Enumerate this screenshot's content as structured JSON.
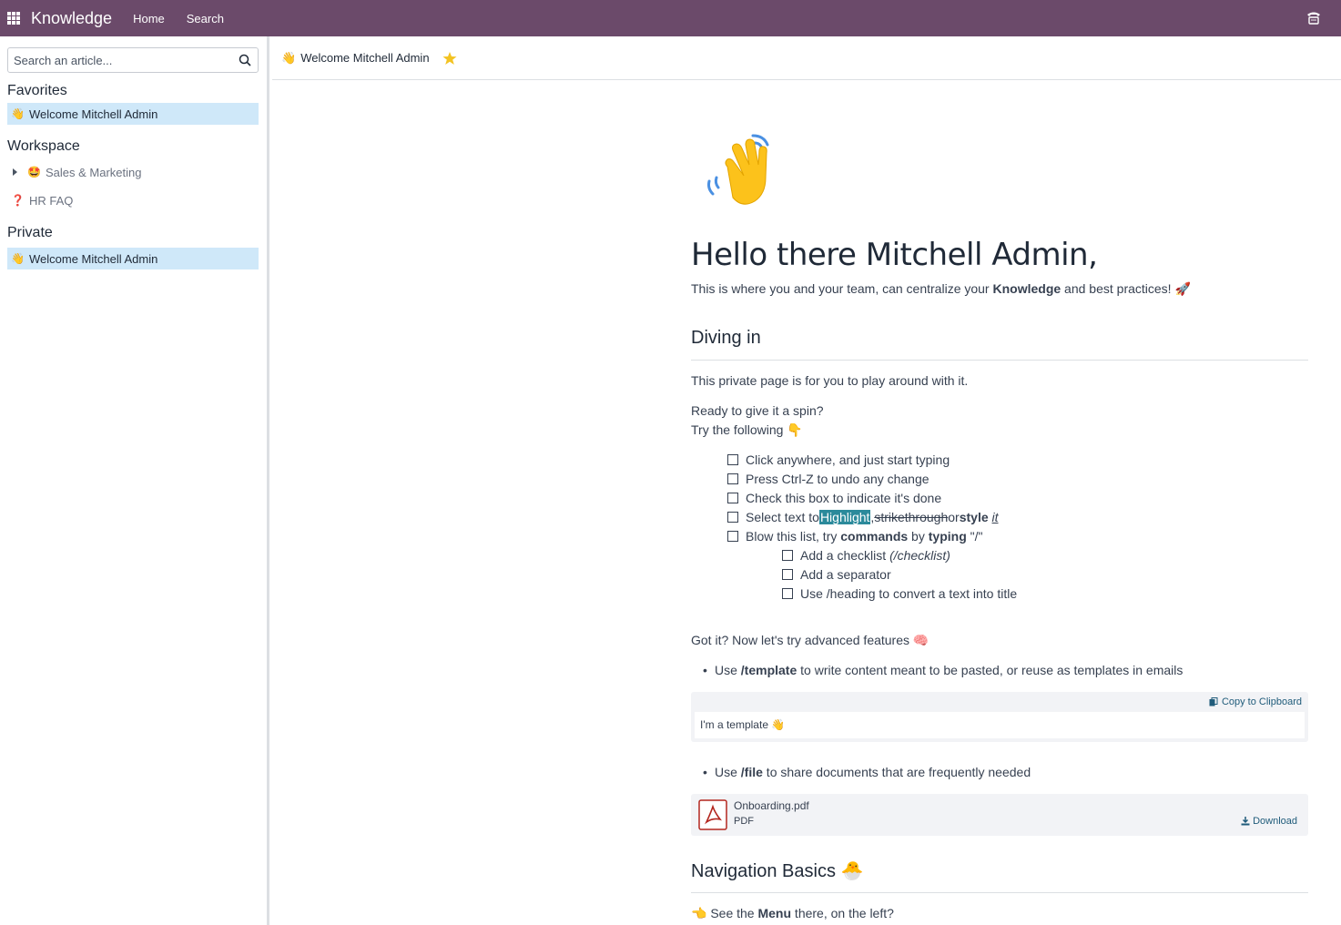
{
  "topbar": {
    "app_name": "Knowledge",
    "nav": [
      "Home",
      "Search"
    ]
  },
  "sidebar": {
    "search_placeholder": "Search an article...",
    "favorites_title": "Favorites",
    "favorites": [
      {
        "emoji": "👋",
        "label": "Welcome Mitchell Admin"
      }
    ],
    "workspace_title": "Workspace",
    "workspace": [
      {
        "emoji": "🤩",
        "label": "Sales & Marketing"
      },
      {
        "emoji": "❓",
        "label": "HR FAQ"
      }
    ],
    "private_title": "Private",
    "private": [
      {
        "emoji": "👋",
        "label": "Welcome Mitchell Admin"
      }
    ]
  },
  "breadcrumb": {
    "emoji": "👋",
    "title": "Welcome Mitchell Admin"
  },
  "article": {
    "heading": "Hello there Mitchell Admin,",
    "intro": {
      "before": "This is where you and your team, can centralize your ",
      "bold": "Knowledge",
      "after": " and best practices! ",
      "emoji": "🚀"
    },
    "diving_in": "Diving in",
    "p1": "This private page is for you to play around with it.",
    "p2": "Ready to give it a spin?",
    "p3": {
      "text": "Try the following ",
      "emoji": "👇"
    },
    "checklist": [
      "Click anywhere, and just start typing",
      "Press Ctrl-Z to undo any change",
      "Check this box to indicate it's done"
    ],
    "check4": {
      "a": "Select text to ",
      "hl": "Highlight",
      "b": ", ",
      "strike": "strikethrough",
      "c": " or ",
      "bold": "style",
      "d": " ",
      "ital": "it"
    },
    "check5": {
      "a": "Blow this list, try ",
      "bold1": "commands",
      "b": " by ",
      "bold2": "typing",
      "c": " \"/\""
    },
    "subchecklist": {
      "item1_a": "Add a checklist ",
      "item1_i": "(/checklist)",
      "item2": "Add a separator",
      "item3": "Use /heading to convert a text into title"
    },
    "advanced": {
      "text": "Got it? Now let's try advanced features ",
      "emoji": "🧠"
    },
    "bullet1": {
      "a": "Use ",
      "bold": "/template",
      "b": " to write content meant to be pasted, or reuse as templates in emails"
    },
    "copy_label": "Copy to Clipboard",
    "template_text": "I'm a template ",
    "template_emoji": "👋",
    "bullet2": {
      "a": "Use ",
      "bold": "/file",
      "b": " to share documents that are frequently needed"
    },
    "file_name": "Onboarding.pdf",
    "file_type": "PDF",
    "download_label": "Download",
    "nav_basics": "Navigation Basics ",
    "nav_basics_emoji": "🐣",
    "menu_line": {
      "emoji": "👈",
      "a": " See the ",
      "bold": "Menu",
      "b": " there, on the left?"
    }
  }
}
